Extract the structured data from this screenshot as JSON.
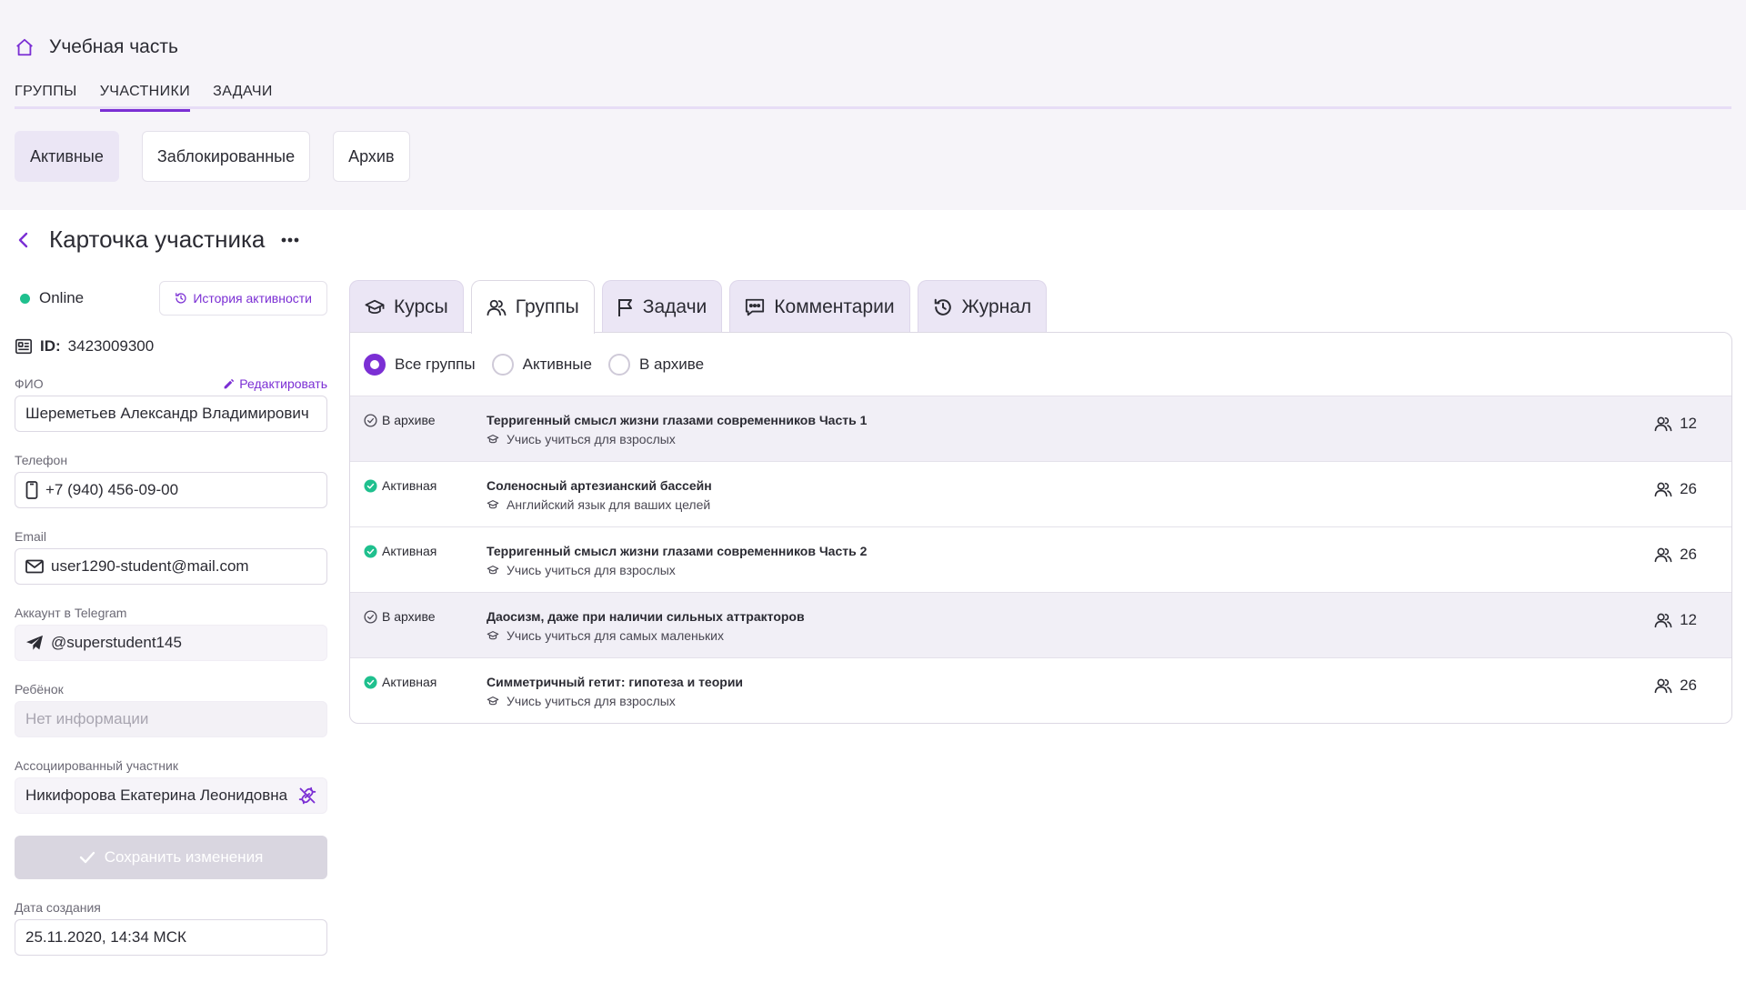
{
  "header": {
    "app_title": "Учебная часть",
    "nav_tabs": [
      "ГРУППЫ",
      "УЧАСТНИКИ",
      "ЗАДАЧИ"
    ],
    "active_nav_tab": "УЧАСТНИКИ",
    "segments": [
      "Активные",
      "Заблокированные",
      "Архив"
    ],
    "active_segment": "Активные"
  },
  "page": {
    "title": "Карточка участника"
  },
  "profile": {
    "status": "Online",
    "history_button": "История активности",
    "id_label": "ID:",
    "id_value": "3423009300",
    "edit_label": "Редактировать",
    "fields": {
      "fio": {
        "label": "ФИО",
        "value": "Шереметьев Александр Владимирович"
      },
      "phone": {
        "label": "Телефон",
        "value": "+7 (940) 456-09-00"
      },
      "email": {
        "label": "Email",
        "value": "user1290-student@mail.com"
      },
      "telegram": {
        "label": "Аккаунт в Telegram",
        "value": "@superstudent145"
      },
      "child": {
        "label": "Ребёнок",
        "placeholder": "Нет информации"
      },
      "associated": {
        "label": "Ассоциированный участник",
        "value": "Никифорова Екатерина Леонидовна"
      },
      "created": {
        "label": "Дата создания",
        "value": "25.11.2020, 14:34 МСК"
      }
    },
    "save_button": "Сохранить изменения"
  },
  "detail_tabs": [
    "Курсы",
    "Группы",
    "Задачи",
    "Комментарии",
    "Журнал"
  ],
  "active_detail_tab": "Группы",
  "filters": {
    "options": [
      "Все группы",
      "Активные",
      "В архиве"
    ],
    "selected": "Все группы"
  },
  "groups": [
    {
      "status": "В архиве",
      "archived": true,
      "name": "Терригенный смысл жизни глазами современников Часть 1",
      "course": "Учись учиться для взрослых",
      "members": "12"
    },
    {
      "status": "Активная",
      "archived": false,
      "name": "Соленосный артезианский бассейн",
      "course": "Английский язык для ваших целей",
      "members": "26"
    },
    {
      "status": "Активная",
      "archived": false,
      "name": "Терригенный смысл жизни глазами современников Часть 2",
      "course": "Учись учиться для взрослых",
      "members": "26"
    },
    {
      "status": "В архиве",
      "archived": true,
      "name": "Даосизм, даже при наличии сильных аттракторов",
      "course": "Учись учиться для самых маленьких",
      "members": "12"
    },
    {
      "status": "Активная",
      "archived": false,
      "name": "Симметричный гетит: гипотеза и теории",
      "course": "Учись учиться для взрослых",
      "members": "26"
    }
  ],
  "colors": {
    "accent": "#7b2fd4",
    "online": "#1fc08e",
    "active_status": "#1fc08e",
    "header_bg": "#f6f4f9",
    "archived_row_bg": "#f1eff6"
  },
  "icons": {
    "app": "home-icon",
    "back": "chevron-left-icon",
    "more": "more-horizontal-icon",
    "history": "history-icon",
    "id": "id-card-icon",
    "edit": "pencil-icon",
    "phone": "phone-icon",
    "email": "mail-icon",
    "telegram": "telegram-icon",
    "unlink": "unlink-icon",
    "save": "check-icon",
    "courses": "graduation-cap-icon",
    "groups": "users-icon",
    "tasks": "flag-icon",
    "comments": "comments-icon",
    "journal": "history-icon"
  }
}
